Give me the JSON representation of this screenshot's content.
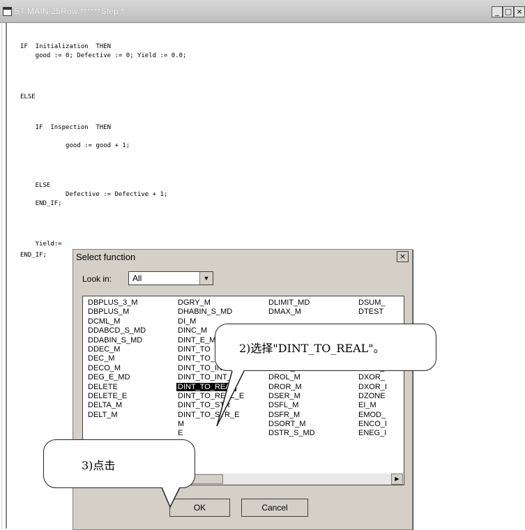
{
  "window": {
    "title": "ST MAIN 25Row ******Step *",
    "minimize": "_",
    "maximize": "□",
    "close": "×"
  },
  "code": {
    "lines": [
      "IF  Initialization  THEN",
      "    good := 0; Defective := 0; Yield := 0.0;",
      "ELSE",
      "    IF  Inspection  THEN",
      "            good := good + 1;",
      "    ELSE",
      "            Defective := Defective + 1;",
      "    END_IF;",
      "    Yield:=",
      "END_IF;"
    ]
  },
  "dialog": {
    "title": "Select function",
    "close": "×",
    "look_in_label": "Look in:",
    "look_in_value": "All",
    "columns": [
      [
        "DBPLUS_3_M",
        "DBPLUS_M",
        "DCML_M",
        "DDABCD_S_MD",
        "DDABIN_S_MD",
        "DDEC_M",
        "DEC_M",
        "DECO_M",
        "DEG_E_MD",
        "DELETE",
        "DELETE_E",
        "DELTA_M",
        "DELT_M"
      ],
      [
        "DGRY_M",
        "DHABIN_S_MD",
        "DI_M",
        "DINC_M",
        "DINT_E_M",
        "DINT_TO",
        "DINT_TO_B",
        "DINT_TO_INT",
        "DINT_TO_INT_E",
        "DINT_TO_REAL",
        "DINT_TO_REAL_E",
        "DINT_TO_STR",
        "DINT_TO_STR_E",
        "M",
        "E"
      ],
      [
        "DLIMIT_MD",
        "DMAX_M",
        "",
        "",
        "",
        "",
        "",
        "DRCR_M",
        "DROL_M",
        "DROR_M",
        "DSER_M",
        "DSFL_M",
        "DSFR_M",
        "DSORT_M",
        "DSTR_S_MD"
      ],
      [
        "DSUM_",
        "DTEST",
        "",
        "",
        "",
        "",
        "_",
        "DXNR_I",
        "DXOR_",
        "DXOR_I",
        "DZONE",
        "EI_M",
        "EMOD_",
        "ENCO_I",
        "ENEG_I"
      ]
    ],
    "selected_item": "DINT_TO_REAL",
    "ok_label": "OK",
    "cancel_label": "Cancel"
  },
  "callouts": {
    "step2": "2)选择\"DINT_TO_REAL\"。",
    "step3": "3)点击"
  },
  "colors": {
    "titlebar": "#c8c8c8",
    "dialog_bg": "#d4d0c8",
    "selection_bg": "#000000"
  }
}
